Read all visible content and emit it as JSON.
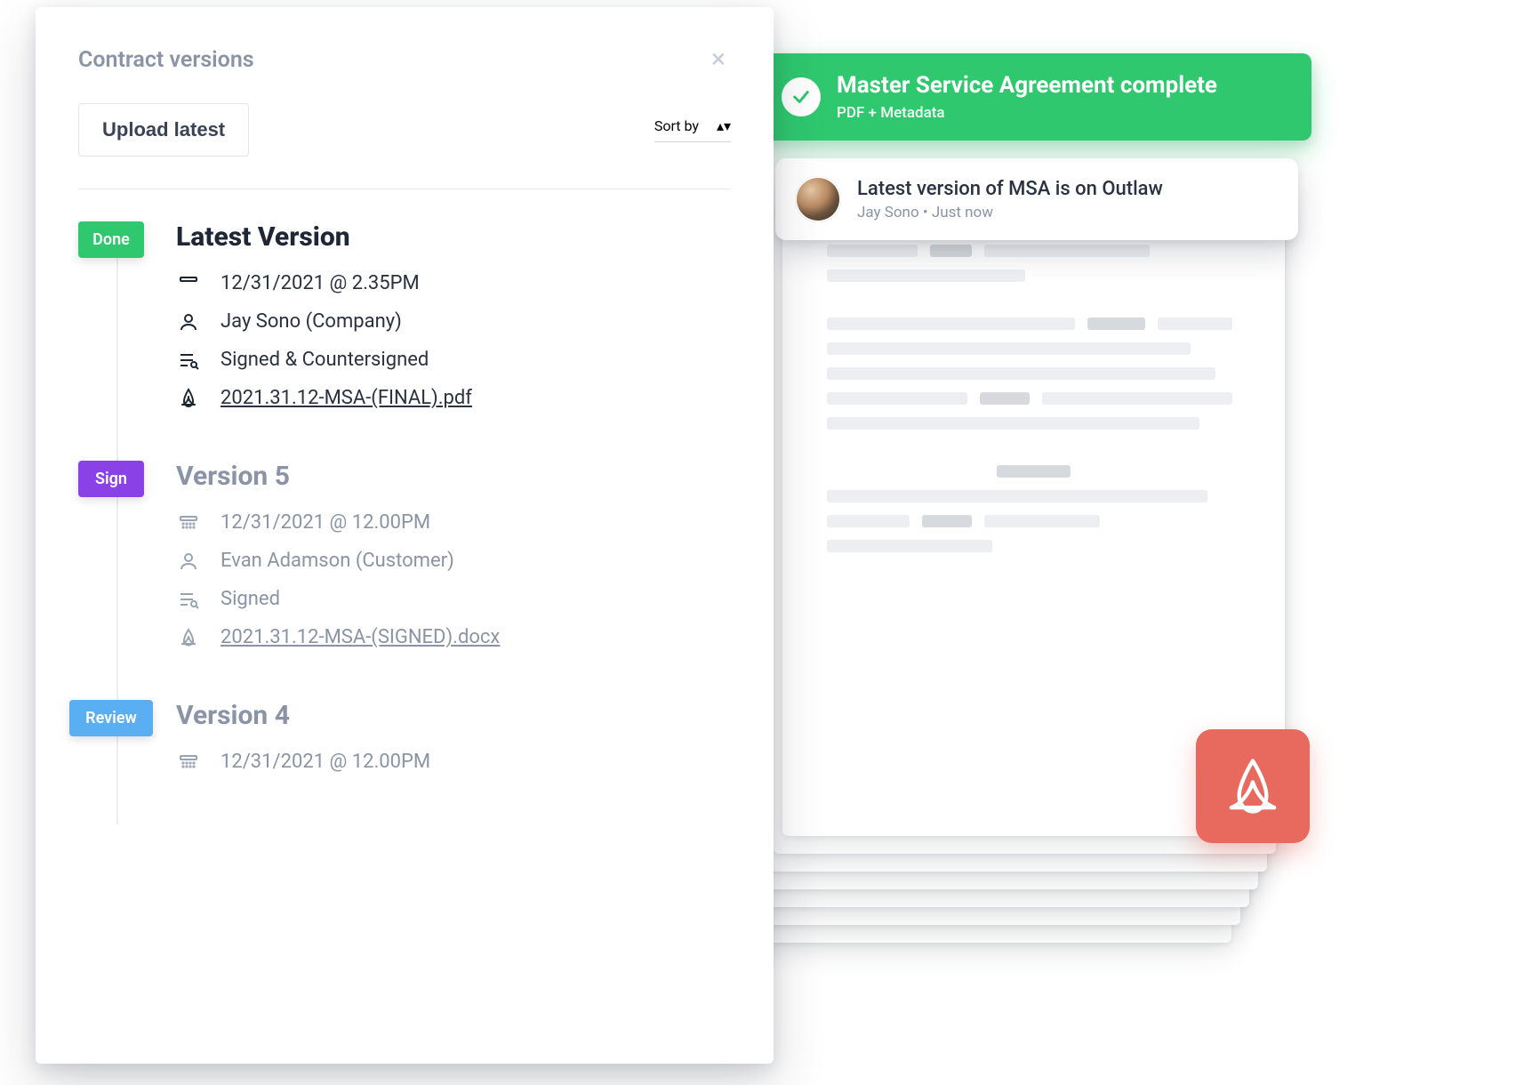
{
  "panel": {
    "title": "Contract versions",
    "upload_label": "Upload latest",
    "sort_label": "Sort by"
  },
  "versions": [
    {
      "pill": "Done",
      "pill_class": "done",
      "title": "Latest Version",
      "muted": false,
      "date": "12/31/2021 @ 2.35PM",
      "person": "Jay Sono (Company)",
      "status": "Signed & Countersigned",
      "file": "2021.31.12-MSA-(FINAL).pdf"
    },
    {
      "pill": "Sign",
      "pill_class": "sign",
      "title": "Version 5",
      "muted": true,
      "date": "12/31/2021 @ 12.00PM",
      "person": "Evan Adamson (Customer)",
      "status": "Signed",
      "file": "2021.31.12-MSA-(SIGNED).docx"
    },
    {
      "pill": "Review",
      "pill_class": "review",
      "title": "Version 4",
      "muted": true,
      "date": "12/31/2021 @ 12.00PM"
    }
  ],
  "banner": {
    "title": "Master Service Agreement complete",
    "subtitle": "PDF + Metadata"
  },
  "notification": {
    "title": "Latest version of MSA is on Outlaw",
    "author": "Jay Sono",
    "sep": " • ",
    "time": "Just now"
  },
  "colors": {
    "green": "#2fc86f",
    "purple": "#8a41e6",
    "blue": "#5aaef2",
    "pdf": "#e86a5e"
  }
}
